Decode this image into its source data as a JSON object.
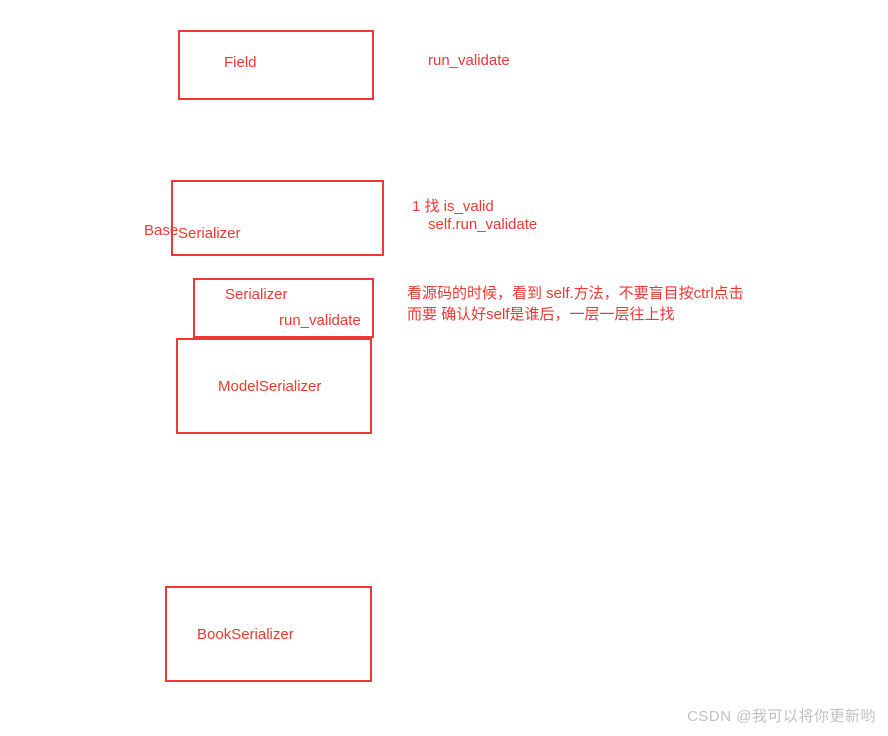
{
  "boxes": {
    "field": {
      "label": "Field"
    },
    "base_serializer": {
      "prefix": "Base",
      "suffix": "Serializer"
    },
    "serializer": {
      "label": "Serializer",
      "method": "run_validate"
    },
    "model_serializer": {
      "label": "ModelSerializer"
    },
    "book_serializer": {
      "label": "BookSerializer"
    }
  },
  "annotations": {
    "field_note": "run_validate",
    "base_note_line1": "1 找 is_valid",
    "base_note_line2": "self.run_validate",
    "serializer_note_line1": "看源码的时候，看到  self.方法，不要盲目按ctrl点击",
    "serializer_note_line2": "而要 确认好self是谁后，一层一层往上找"
  },
  "watermark": "CSDN @我可以将你更新哟"
}
